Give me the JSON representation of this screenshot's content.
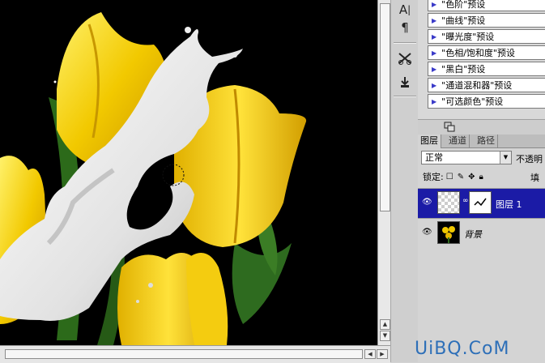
{
  "canvas": {
    "description_colors": {
      "background": "#000000",
      "tulip": "#f0c800",
      "milk": "#e6e6e6",
      "leaf": "#2f6b1e"
    }
  },
  "toolstrip": {
    "tools": [
      {
        "icon": "character-icon",
        "glyph": "A|"
      },
      {
        "icon": "paragraph-icon",
        "glyph": "¶"
      },
      {
        "icon": "tools-preset-icon",
        "glyph": "✂"
      },
      {
        "icon": "clone-source-icon",
        "glyph": "⇓"
      }
    ]
  },
  "presets": {
    "items": [
      {
        "label": "\"色阶\"预设"
      },
      {
        "label": "\"曲线\"预设"
      },
      {
        "label": "\"曝光度\"预设"
      },
      {
        "label": "\"色相/饱和度\"预设"
      },
      {
        "label": "\"黑白\"预设"
      },
      {
        "label": "\"通道混和器\"预设"
      },
      {
        "label": "\"可选颜色\"预设"
      }
    ],
    "footer_icon": "adjustment-return-icon"
  },
  "layers_panel": {
    "tabs": [
      {
        "label": "图层",
        "active": true
      },
      {
        "label": "通道",
        "active": false
      },
      {
        "label": "路径",
        "active": false
      }
    ],
    "blend_mode": "正常",
    "opacity_label": "不透明",
    "lock_label": "锁定:",
    "fill_label": "填",
    "layers": [
      {
        "name": "图层 1",
        "selected": true
      },
      {
        "name": "背景",
        "selected": false
      }
    ]
  },
  "watermark": "UiBQ.CoM"
}
